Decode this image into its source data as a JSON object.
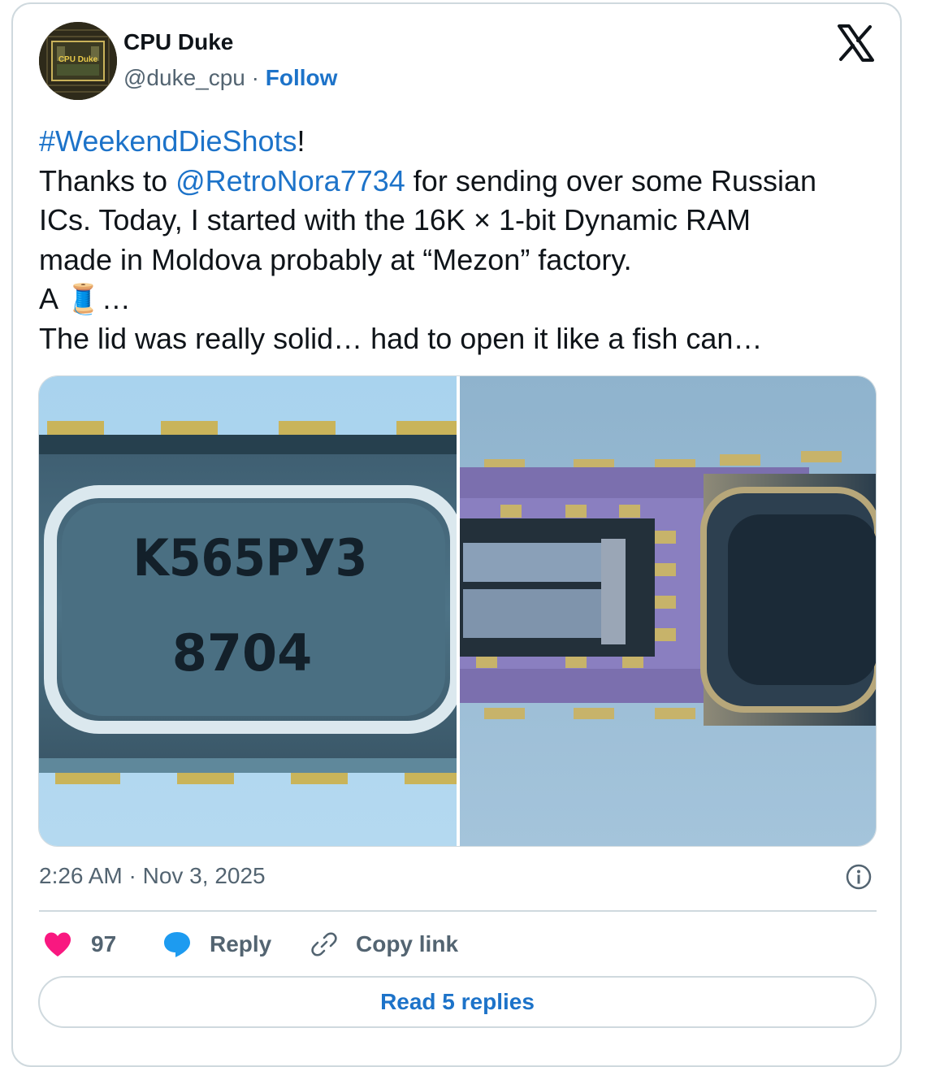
{
  "author": {
    "name": "CPU Duke",
    "handle": "@duke_cpu",
    "separator": "·",
    "follow_label": "Follow",
    "avatar_text": "CPU Duke"
  },
  "brand": {
    "logo_icon": "x-logo-icon",
    "accent_color": "#1d73c9",
    "like_color": "#f91880",
    "reply_color": "#1d9bf0"
  },
  "tweet": {
    "hashtag": "#WeekendDieShots",
    "hashtag_suffix": "!",
    "line2_prefix": "Thanks to ",
    "mention": "@RetroNora7734",
    "line2_suffix": " for sending over some Russian",
    "line3": "ICs. Today, I started with the 16K × 1-bit Dynamic RAM",
    "line4": "made in Moldova probably at “Mezon” factory.",
    "line5_prefix": "A ",
    "line5_emoji": "🧵",
    "line5_suffix": "…",
    "line6": "The lid was really solid… had to open it like a fish can…"
  },
  "media": {
    "left_photo": {
      "chip_marking_line1": "K565PУ3",
      "chip_marking_line2": "8704"
    },
    "right_photo": {}
  },
  "meta": {
    "timestamp": "2:26 AM · Nov 3, 2025",
    "info_icon": "info-icon"
  },
  "actions": {
    "like_count": "97",
    "reply_label": "Reply",
    "copy_link_label": "Copy link",
    "read_replies_label": "Read 5 replies"
  }
}
